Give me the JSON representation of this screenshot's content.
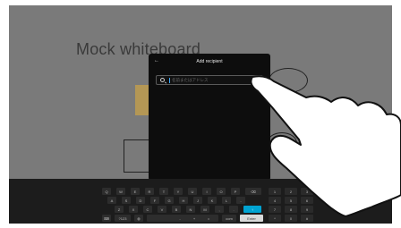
{
  "whiteboard": {
    "title": "Mock whiteboard"
  },
  "dialog": {
    "back_icon": "arrow-left-icon",
    "title": "Add recipient",
    "search": {
      "icon": "search-icon",
      "placeholder": "名前またはアドレス"
    }
  },
  "keyboard": {
    "row1": [
      "Q",
      "W",
      "E",
      "R",
      "T",
      "Y",
      "U",
      "I",
      "O",
      "P",
      "⌫"
    ],
    "row2": [
      "A",
      "S",
      "D",
      "F",
      "G",
      "H",
      "J",
      "K",
      "L",
      "-"
    ],
    "row3": [
      "Z",
      "X",
      "C",
      "V",
      "B",
      "N",
      "M",
      ",",
      ".",
      "↑"
    ],
    "row4": [
      "⌨",
      "?123",
      "◍",
      "-",
      "+",
      "=",
      "com",
      "Enter"
    ],
    "numpad": {
      "row1": [
        "1",
        "2",
        "3"
      ],
      "row2": [
        "4",
        "5",
        "6"
      ],
      "row3": [
        "7",
        "8",
        "9"
      ],
      "row4": [
        "*",
        "0",
        "#"
      ]
    }
  },
  "colors": {
    "background": "#7a7a7a",
    "dialog": "#0d0d0d",
    "keyboard": "#1c1c1c",
    "accent": "#00a3d2",
    "caret": "#3ea9ff"
  }
}
